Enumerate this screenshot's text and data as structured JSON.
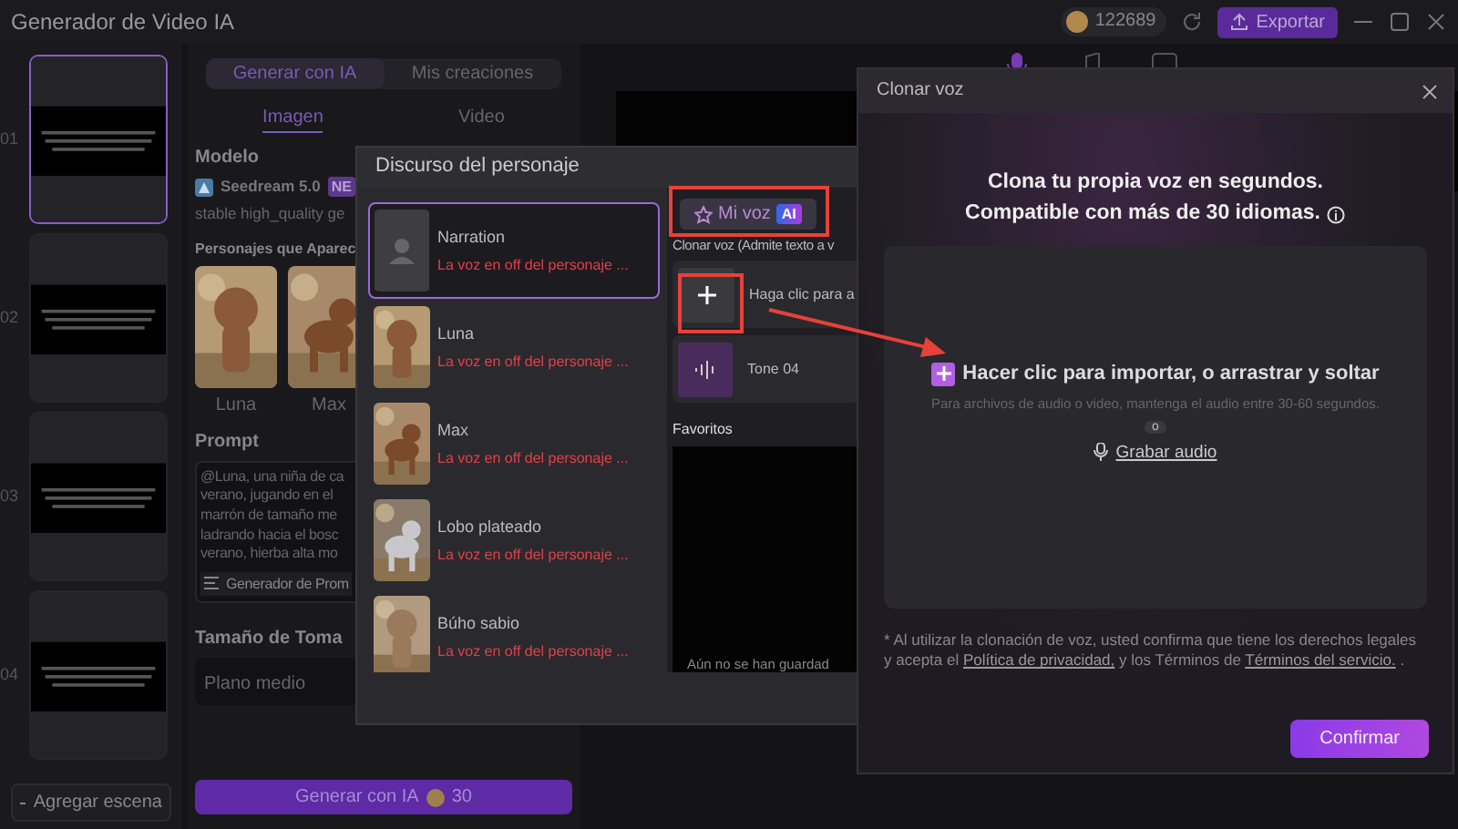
{
  "app": {
    "title": "Generador de Video IA",
    "credits": "122689",
    "export": "Exportar"
  },
  "scenes": [
    {
      "number": "01",
      "selected": true
    },
    {
      "number": "02",
      "selected": false
    },
    {
      "number": "03",
      "selected": false
    },
    {
      "number": "04",
      "selected": false
    }
  ],
  "add_scene": "Agregar escena",
  "panel": {
    "tabs": [
      {
        "label": "Generar con IA",
        "selected": true
      },
      {
        "label": "Mis creaciones",
        "selected": false
      }
    ],
    "subtabs": [
      {
        "label": "Imagen",
        "selected": true
      },
      {
        "label": "Video",
        "selected": false
      }
    ],
    "model_label": "Modelo",
    "model_name": "Seedream 5.0",
    "model_badge": "NE",
    "model_desc": "stable high_quality ge",
    "characters_label": "Personajes que Aparec",
    "characters": [
      {
        "name": "Luna",
        "kind": "girl"
      },
      {
        "name": "Max",
        "kind": "dog"
      }
    ],
    "prompt_label": "Prompt",
    "prompt_lines": [
      "@Luna, una niña de ca",
      "verano, jugando en el",
      "marrón de tamaño me",
      "ladrando hacia el bosc",
      "verano, hierba alta mo"
    ],
    "prompt_generator": "Generador de Prom",
    "shot_label": "Tamaño de Toma",
    "shot_value": "Plano medio",
    "generate": "Generar con IA",
    "generate_cost": "30"
  },
  "speech_dialog": {
    "title": "Discurso del personaje",
    "voices": [
      {
        "name": "Narration",
        "description": "La voz en off del personaje ...",
        "selected": true,
        "kind": "placeholder"
      },
      {
        "name": "Luna",
        "description": "La voz en off del personaje ...",
        "selected": false,
        "kind": "girl"
      },
      {
        "name": "Max",
        "description": "La voz en off del personaje ...",
        "selected": false,
        "kind": "dog"
      },
      {
        "name": "Lobo plateado",
        "description": "La voz en off del personaje ...",
        "selected": false,
        "kind": "wolf"
      },
      {
        "name": "Búho sabio",
        "description": "La voz en off del personaje ...",
        "selected": false,
        "kind": "owl"
      }
    ],
    "tab": "Mi voz",
    "tab_badge": "AI",
    "clone_label": "Clonar voz (Admite texto a v",
    "add_label": "Haga clic para a",
    "tone": "Tone 04",
    "favorites": "Favoritos",
    "empty": "Aún no se han guardad"
  },
  "clone_dialog": {
    "title": "Clonar voz",
    "headline": [
      "Clona tu propia voz en segundos.",
      "Compatible con más de 30 idiomas."
    ],
    "import_label": "Hacer clic para importar, o arrastrar y soltar",
    "hint": "Para archivos de audio o video, mantenga el audio entre 30-60 segundos.",
    "or": "o",
    "record": "Grabar audio",
    "disclaimer": {
      "before": "* Al utilizar la clonación de voz, usted confirma que tiene los derechos legales y acepta el ",
      "privacy": "Política de privacidad,",
      "middle": " y los Términos de ",
      "terms": "Términos del servicio.",
      "after": " ."
    },
    "confirm": "Confirmar"
  }
}
